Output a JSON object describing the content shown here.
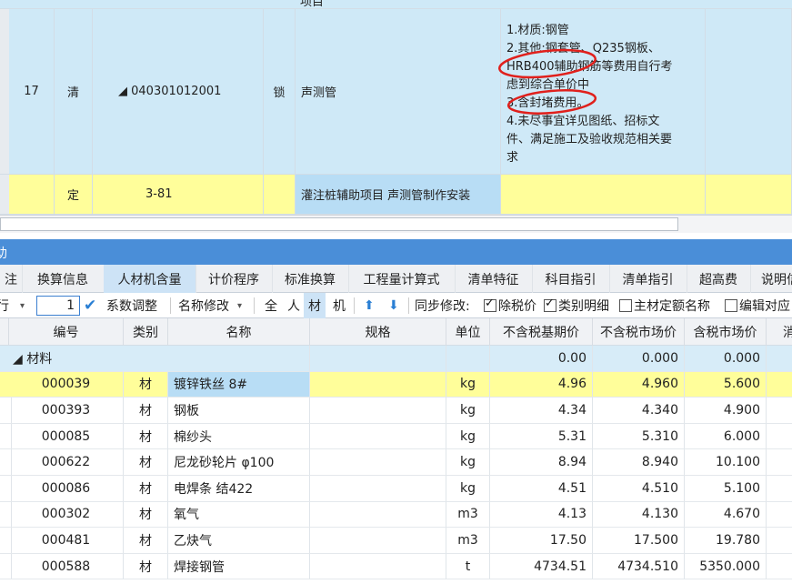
{
  "upper": {
    "row17": {
      "num": "17",
      "type": "清",
      "code": "◢ 040301012001",
      "lock": "锁",
      "name": "声测管",
      "desc": [
        "1.材质:钢管",
        "2.其他:钢套管、Q235钢板、",
        "HRB400辅助钢筋等费用自行考",
        "虑到综合单价中",
        "3.含封堵费用。",
        "4.未尽事宜详见图纸、招标文",
        "件、满足施工及验收规范相关要",
        "求"
      ]
    },
    "rowdef": {
      "type": "定",
      "code": "3-81",
      "name": "灌注桩辅助项目 声测管制作安装"
    },
    "top_partial": "项目"
  },
  "panel_title_fragment": "助",
  "tabs": [
    "注",
    "换算信息",
    "人材机含量",
    "计价程序",
    "标准换算",
    "工程量计算式",
    "清单特征",
    "科目指引",
    "清单指引",
    "超高费",
    "说明信"
  ],
  "active_tab": "人材机含量",
  "toolbar": {
    "row_label": "行",
    "qty_value": "1",
    "coef_label": "系数调整",
    "rename_label": "名称修改",
    "filters": [
      "全",
      "人",
      "材",
      "机"
    ],
    "active_filter": "材",
    "sync_label": "同步修改:",
    "check1_label": "除税价",
    "check2_label": "类别明细",
    "check3_label": "主材定额名称",
    "check4_label": "编辑对应"
  },
  "lower": {
    "columns": [
      "编号",
      "类别",
      "名称",
      "规格",
      "单位",
      "不含税基期价",
      "不含税市场价",
      "含税市场价",
      "消"
    ],
    "group": {
      "label": "◢ 材料",
      "v1": "0.00",
      "v2": "0.000",
      "v3": "0.000"
    },
    "rows": [
      {
        "code": "000039",
        "cat": "材",
        "name": "镀锌铁丝 8#",
        "spec": "",
        "unit": "kg",
        "base": "4.96",
        "market": "4.960",
        "tax": "5.600"
      },
      {
        "code": "000393",
        "cat": "材",
        "name": "钢板",
        "spec": "",
        "unit": "kg",
        "base": "4.34",
        "market": "4.340",
        "tax": "4.900"
      },
      {
        "code": "000085",
        "cat": "材",
        "name": "棉纱头",
        "spec": "",
        "unit": "kg",
        "base": "5.31",
        "market": "5.310",
        "tax": "6.000"
      },
      {
        "code": "000622",
        "cat": "材",
        "name": "尼龙砂轮片 φ100",
        "spec": "",
        "unit": "kg",
        "base": "8.94",
        "market": "8.940",
        "tax": "10.100"
      },
      {
        "code": "000086",
        "cat": "材",
        "name": "电焊条 结422",
        "spec": "",
        "unit": "kg",
        "base": "4.51",
        "market": "4.510",
        "tax": "5.100"
      },
      {
        "code": "000302",
        "cat": "材",
        "name": "氧气",
        "spec": "",
        "unit": "m3",
        "base": "4.13",
        "market": "4.130",
        "tax": "4.670"
      },
      {
        "code": "000481",
        "cat": "材",
        "name": "乙炔气",
        "spec": "",
        "unit": "m3",
        "base": "17.50",
        "market": "17.500",
        "tax": "19.780"
      },
      {
        "code": "000588",
        "cat": "材",
        "name": "焊接钢管",
        "spec": "",
        "unit": "t",
        "base": "4734.51",
        "market": "4734.510",
        "tax": "5350.000"
      }
    ]
  },
  "colors": {
    "selected_row": "#fffe9a",
    "row_blue": "#cfe9f7",
    "header_band": "#4a8ed8",
    "annotation_red": "#e0201c"
  }
}
